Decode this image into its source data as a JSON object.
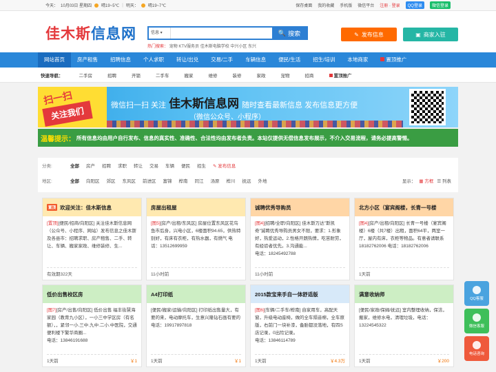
{
  "topbar": {
    "today_label": "今天：",
    "today_date": "10月03日 星期四",
    "today_weather": "晴19~5℃",
    "tomorrow_label": "明天：",
    "tomorrow_weather": "晴19~7℃",
    "links": [
      "保存桌面",
      "我的收藏",
      "手机版",
      "微信平台"
    ],
    "register": "注册",
    "login": "登录",
    "qq_login": "QQ登录",
    "wx_login": "微信登录"
  },
  "header": {
    "logo_red": "佳木斯",
    "logo_blue": "信息网",
    "search_category": "信息",
    "search_placeholder": "",
    "search_button": "搜索",
    "hot_label": "热门搜索：",
    "hot_terms": "宠物 KTV服务员 佳木斯电脑学校 中兴小区 东兴",
    "publish_button": "发布信息",
    "merchant_button": "商家入驻"
  },
  "nav": {
    "items": [
      "网站首页",
      "房产租售",
      "招聘信息",
      "个人求职",
      "转让/出兑",
      "交易/二手",
      "车辆信息",
      "便民/生活",
      "招生/培训",
      "本地商家",
      "置顶推广"
    ]
  },
  "quick": {
    "label": "快速导航：",
    "items": [
      "二手房",
      "招聘",
      "开锁",
      "二手车",
      "搬家",
      "维修",
      "装修",
      "家政",
      "宠物",
      "招商"
    ],
    "promo": "置顶推广"
  },
  "banner": {
    "stamp_top": "扫一扫",
    "stamp_bottom": "关注我们",
    "line1_pre": "微信扫一扫  关注",
    "line1_big": "佳木斯信息网",
    "line1_post": "随时查看最新信息 发布信息更方便",
    "line2": "（微信公众号、小程序）"
  },
  "notice": {
    "tag": "温馨提示：",
    "text": "所有信息均由用户自行发布、信息的真实性、准确性、合法性均由发布者负责。本站仅提供无偿信息发布展示，不介入交易流程，请务必提高警惕。"
  },
  "filter": {
    "category_label": "分类:",
    "categories": [
      "全部",
      "房产",
      "招聘",
      "求职",
      "转让",
      "交易",
      "车辆",
      "便民",
      "招生"
    ],
    "publish_link": "发布信息",
    "area_label": "地区:",
    "areas": [
      "全部",
      "向阳区",
      "郊区",
      "东风区",
      "前进区",
      "富锦",
      "桦南",
      "同江",
      "汤原",
      "桦川",
      "抚远",
      "外地"
    ],
    "display_label": "显示：",
    "grid_view": "方框",
    "list_view": "列表"
  },
  "cards": [
    {
      "title": "欢迎关注：佳木斯信息",
      "icon": "置顶",
      "color": "y",
      "cat": "[置顶]",
      "text": "[便民/招商/向阳区] 关注佳木斯信息网（公众号、小程序、网站）发布信息之佳木斯及各县市：招聘求职、房产租售、二手、转让、车辆、搬家家政、维修装修、生...",
      "time": "有效期322天",
      "price": ""
    },
    {
      "title": "房屋出租屋",
      "icon": "",
      "color": "y",
      "cat": "[图5]",
      "text": "[房产/出租/东风区] 房屋位置东风区花鸟鱼市后身，兴电小区，6楼面积94.65，供热特别好，有床有衣柜，有热水器，有燃气 电话：13512699959",
      "time": "11小时前",
      "price": ""
    },
    {
      "title": "诚聘优秀导购员",
      "icon": "",
      "color": "o",
      "cat": "[图4]",
      "text": "[招聘/全职/向阳区] 佳木斯万达\"斯凯奇\"诚聘优秀导购员男女不限，要求：1.形象好，热爱运动，2.性格开朗热情，吃苦耐劳，有经验者优先。3.沟通能...",
      "time": "11小时前",
      "price": "",
      "phone": "电话：18245492788"
    },
    {
      "title": "北方小区（宴宾阁楼，长青一号楼",
      "icon": "",
      "color": "o",
      "cat": "[图4]",
      "text": "[房产/出租/向阳区] 长青一号楼（宴宾阁楼）6楼（共7楼）出租，面积64平，两室一厅，屋内有床，衣柜等物品。有意者请联系18182762006 电话：18182762006",
      "time": "1天前",
      "price": ""
    },
    {
      "title": "低价出售校区房",
      "icon": "",
      "color": "g",
      "cat": "[图7]",
      "text": "[房产/出售/向阳区] 低价出售 福丰街慧海家园（教育九小区），一小三中学区房（有名额），，紧邻一小.三中.九中.二小.中医院，交通便利楼下繁华商圈...",
      "time": "1天前",
      "price": "￥1",
      "phone": "电话：13846191688"
    },
    {
      "title": "A4打印纸",
      "icon": "",
      "color": "g",
      "cat": "",
      "text": "[便民/搬家/运输/向阳区] 打印纸出售量大，有要的来，电动摩托车，生意兴隆钻石画有要的 电话：19917897818",
      "time": "1天前",
      "price": "￥1"
    },
    {
      "title": "2015款宝来手自一体舒适版",
      "icon": "",
      "color": "b",
      "cat": "[图6]",
      "text": "[车辆/二手车/桦南] 自家用车，高配天窗，升级电动座椅，做的全车隔音棉，全车原版，右前门一块补漆，备胎都没落地，有四S店记录，0出险记录。",
      "time": "1天前",
      "price": "￥4.3万",
      "phone": "电话：13846114789"
    },
    {
      "title": "满意收纳师",
      "icon": "",
      "color": "g",
      "cat": "",
      "text": "[便民/家政/保姆/抚远] 室内整理收纳，保洁，搬家，维修水电，清理垃圾，电话：13224545322",
      "time": "1天前",
      "price": "￥200"
    }
  ],
  "side": [
    "QQ客服",
    "微信客服",
    "电话咨询"
  ]
}
